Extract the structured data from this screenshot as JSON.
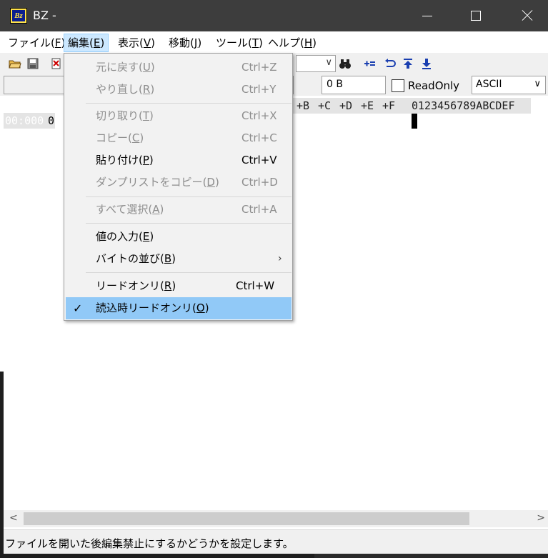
{
  "window": {
    "title": "BZ -"
  },
  "menubar": [
    {
      "label": "ファイル",
      "mnemonic": "F"
    },
    {
      "label": "編集",
      "mnemonic": "E"
    },
    {
      "label": "表示",
      "mnemonic": "V"
    },
    {
      "label": "移動",
      "mnemonic": "J"
    },
    {
      "label": "ツール",
      "mnemonic": "T"
    },
    {
      "label": "ヘルプ",
      "mnemonic": "H"
    }
  ],
  "toolbar": {
    "icons": [
      "open-folder-icon",
      "save-icon",
      "cut-icon",
      "binoculars-icon",
      "increment-icon",
      "undo-arrow-icon",
      "jump-top-icon",
      "jump-down-icon"
    ]
  },
  "statusrow": {
    "size": "0 B",
    "readonly_label": "ReadOnly",
    "readonly_checked": false,
    "encoding": "ASCII"
  },
  "editor": {
    "header_cols": [
      "+B",
      "+C",
      "+D",
      "+E",
      "+F"
    ],
    "ascii_header": "0123456789ABCDEF",
    "address": "00:000",
    "first_byte": "0"
  },
  "edit_menu": {
    "items": [
      {
        "label": "元に戻す",
        "mnemonic": "U",
        "shortcut": "Ctrl+Z",
        "enabled": false
      },
      {
        "label": "やり直し",
        "mnemonic": "R",
        "shortcut": "Ctrl+Y",
        "enabled": false
      },
      {
        "label": "切り取り",
        "mnemonic": "T",
        "shortcut": "Ctrl+X",
        "enabled": false
      },
      {
        "label": "コピー",
        "mnemonic": "C",
        "shortcut": "Ctrl+C",
        "enabled": false
      },
      {
        "label": "貼り付け",
        "mnemonic": "P",
        "shortcut": "Ctrl+V",
        "enabled": true
      },
      {
        "label": "ダンプリストをコピー",
        "mnemonic": "D",
        "shortcut": "Ctrl+D",
        "enabled": false
      },
      {
        "label": "すべて選択",
        "mnemonic": "A",
        "shortcut": "Ctrl+A",
        "enabled": false
      },
      {
        "label": "値の入力",
        "mnemonic": "E",
        "shortcut": "",
        "enabled": true
      },
      {
        "label": "バイトの並び",
        "mnemonic": "B",
        "shortcut": "",
        "enabled": true,
        "submenu": true
      },
      {
        "label": "リードオンリ",
        "mnemonic": "R",
        "shortcut": "Ctrl+W",
        "enabled": true
      },
      {
        "label": "読込時リードオンリ",
        "mnemonic": "O",
        "shortcut": "",
        "enabled": true,
        "checked": true,
        "highlighted": true
      }
    ]
  },
  "status_bar": {
    "text": "ファイルを開いた後編集禁止にするかどうかを設定します。"
  }
}
